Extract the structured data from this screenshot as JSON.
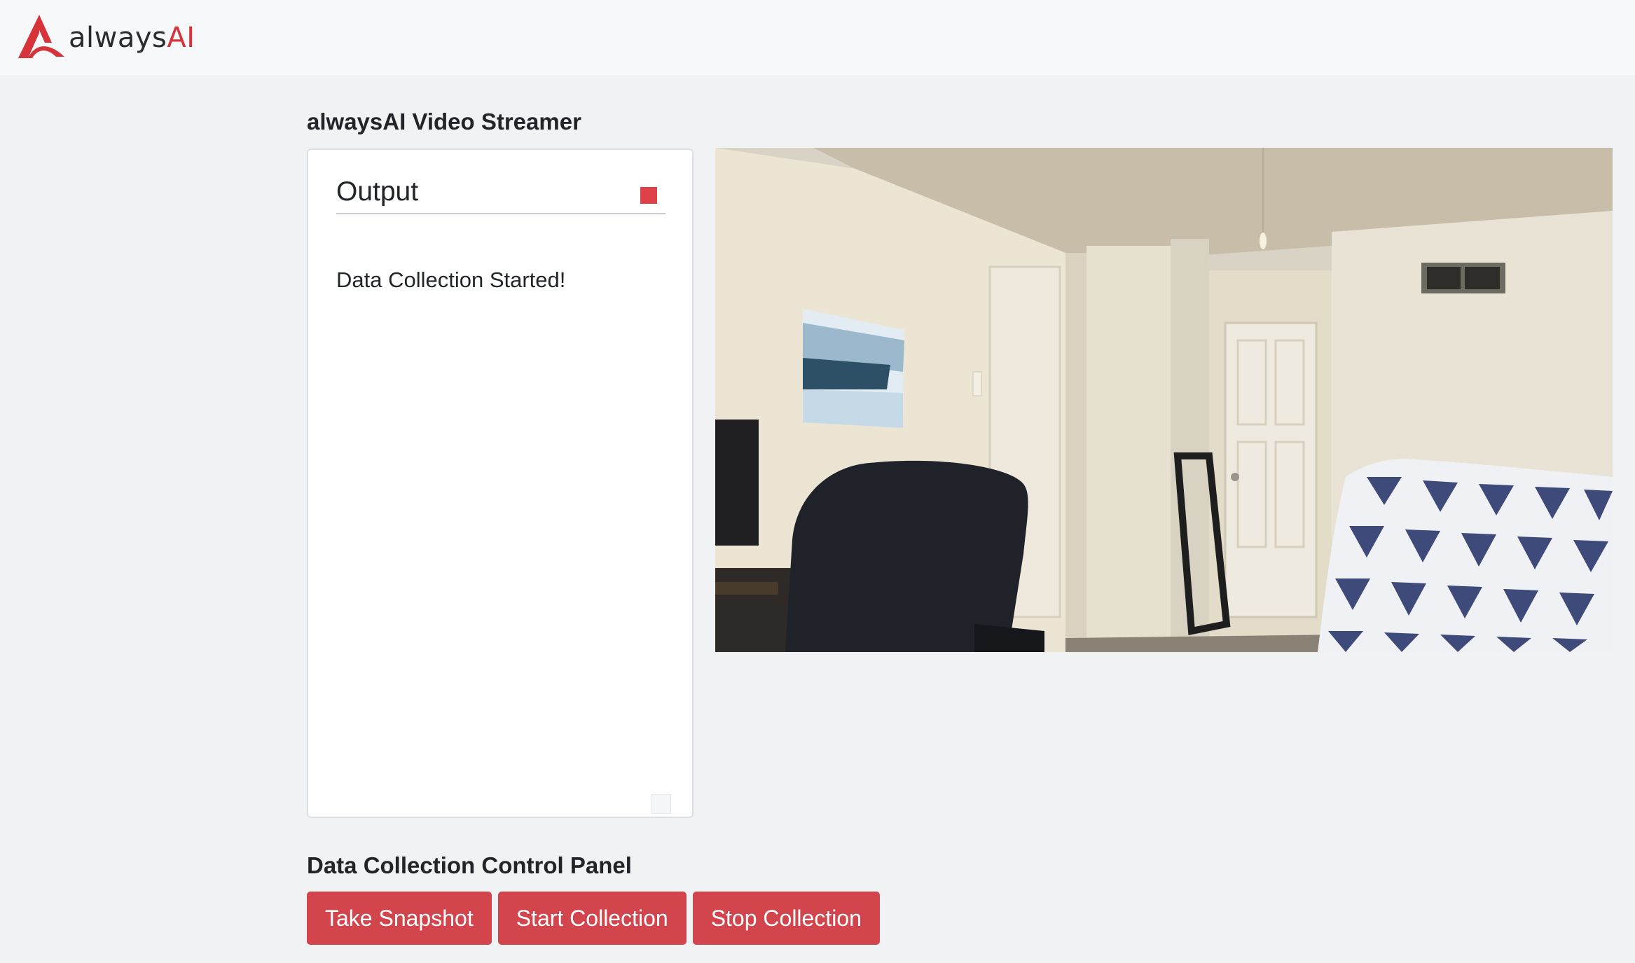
{
  "navbar": {
    "brand_name_prefix": "always",
    "brand_name_suffix": "AI",
    "brand_color": "#d6333a"
  },
  "streamer": {
    "title": "alwaysAI Video Streamer"
  },
  "output": {
    "header": "Output",
    "indicator_color": "#df4148",
    "message": "Data Collection Started!"
  },
  "control_panel": {
    "title": "Data Collection Control Panel",
    "buttons": [
      {
        "label": "Take Snapshot"
      },
      {
        "label": "Start Collection"
      },
      {
        "label": "Stop Collection"
      }
    ],
    "button_color": "#d3454d"
  }
}
